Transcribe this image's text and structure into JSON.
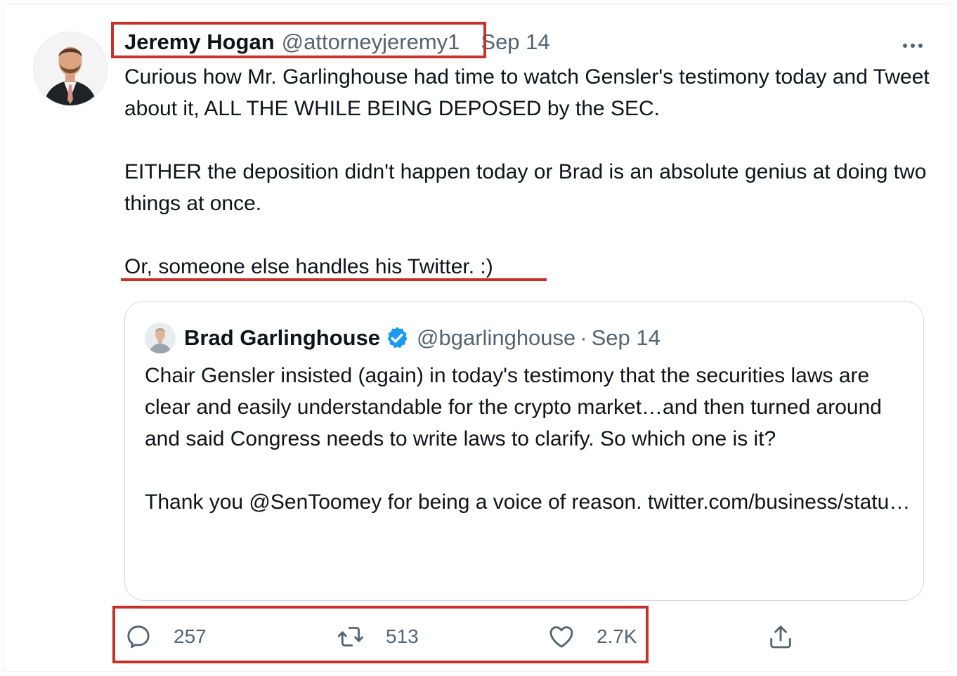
{
  "tweet": {
    "author_name": "Jeremy Hogan",
    "author_handle": "@attorneyjeremy1",
    "date": "Sep 14",
    "paragraphs": [
      "Curious how Mr. Garlinghouse had time to watch Gensler's testimony today and Tweet about it, ALL THE WHILE BEING DEPOSED by the SEC.",
      "EITHER the deposition didn't happen today or Brad is an absolute genius at doing two things at once.",
      "Or, someone else handles his Twitter.  :)"
    ]
  },
  "quoted_tweet": {
    "author_name": "Brad Garlinghouse",
    "author_handle": "@bgarlinghouse",
    "separator": "·",
    "date": "Sep 14",
    "paragraphs": [
      "Chair Gensler insisted (again) in today's testimony that the securities laws are clear and easily understandable for the crypto market…and then turned around and said Congress needs to write laws to clarify. So which one is it?",
      "Thank you @SenToomey for being a voice of reason. twitter.com/business/statu…"
    ]
  },
  "actions": {
    "reply_count": "257",
    "retweet_count": "513",
    "like_count": "2.7K"
  },
  "icons": {
    "reply": "reply-icon",
    "retweet": "retweet-icon",
    "like": "heart-icon",
    "share": "share-icon",
    "more": "more-icon",
    "verified": "verified-badge-icon"
  },
  "colors": {
    "text_primary": "#0f1419",
    "text_secondary": "#536471",
    "verified_blue": "#1d9bf0",
    "annotation_red": "#c8312b",
    "quote_border": "#cfd9de"
  }
}
